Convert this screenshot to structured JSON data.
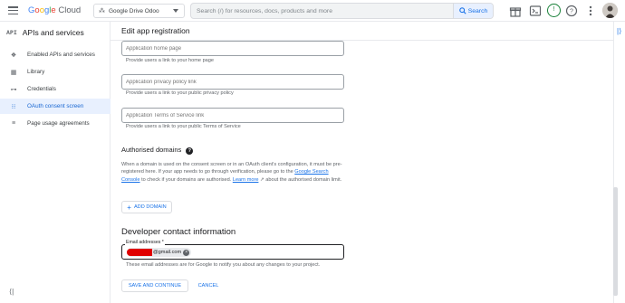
{
  "header": {
    "logo_word": "Google",
    "logo_product": "Cloud",
    "project_name": "Google Drive Odoo",
    "search_placeholder": "Search (/) for resources, docs, products and more",
    "search_button": "Search",
    "trial_badge": "!"
  },
  "sidebar": {
    "badge": "API",
    "title": "APIs and services",
    "items": [
      {
        "label": "Enabled APIs and services",
        "icon": "diamond-grid-icon",
        "active": false
      },
      {
        "label": "Library",
        "icon": "library-icon",
        "active": false
      },
      {
        "label": "Credentials",
        "icon": "key-icon",
        "active": false
      },
      {
        "label": "OAuth consent screen",
        "icon": "consent-icon",
        "active": true
      },
      {
        "label": "Page usage agreements",
        "icon": "agreement-icon",
        "active": false
      }
    ]
  },
  "main": {
    "title": "Edit app registration",
    "fields": [
      {
        "placeholder": "Application home page",
        "help": "Provide users a link to your home page"
      },
      {
        "placeholder": "Application privacy policy link",
        "help": "Provide users a link to your public privacy policy"
      },
      {
        "placeholder": "Application Terms of Service link",
        "help": "Provide users a link to your public Terms of Service"
      }
    ],
    "authorised_domains": {
      "title": "Authorised domains",
      "para_1": "When a domain is used on the consent screen or in an OAuth client's configuration, it must be pre-registered here. If your app needs to go through verification, please go to the ",
      "link_1": "Google Search Console",
      "para_2": " to check if your domains are authorised. ",
      "link_2": "Learn more",
      "para_3": " about the authorised domain limit.",
      "add_button": "ADD DOMAIN"
    },
    "developer_contact": {
      "title": "Developer contact information",
      "email_label": "Email addresses *",
      "email_chip_suffix": "@gmail.com",
      "help": "These email addresses are for Google to notify you about any changes to your project."
    },
    "actions": {
      "save": "SAVE AND CONTINUE",
      "cancel": "CANCEL"
    }
  },
  "colors": {
    "accent": "#1a73e8",
    "active_bg": "#e8f0fe",
    "redaction": "#e00000"
  }
}
